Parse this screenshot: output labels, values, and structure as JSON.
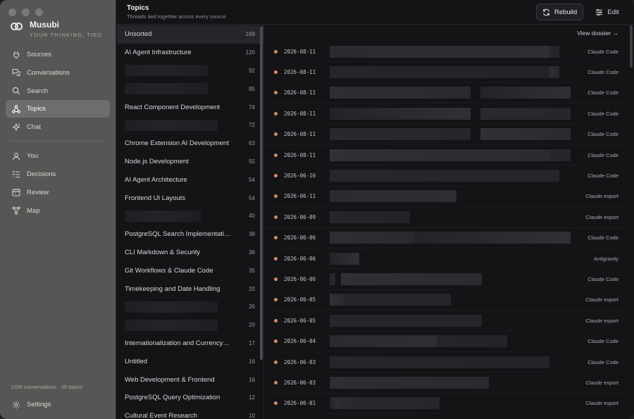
{
  "app": {
    "name": "Musubi",
    "tagline": "YOUR THINKING, TIED"
  },
  "sidebar": {
    "primary": [
      {
        "label": "Sources",
        "icon": "plug-icon",
        "active": false
      },
      {
        "label": "Conversations",
        "icon": "chat-bubbles-icon",
        "active": false
      },
      {
        "label": "Search",
        "icon": "search-icon",
        "active": false
      },
      {
        "label": "Topics",
        "icon": "topics-graph-icon",
        "active": true
      },
      {
        "label": "Chat",
        "icon": "sparkle-icon",
        "active": false
      }
    ],
    "secondary": [
      {
        "label": "You",
        "icon": "person-icon"
      },
      {
        "label": "Decisions",
        "icon": "checklist-icon"
      },
      {
        "label": "Review",
        "icon": "calendar-icon"
      },
      {
        "label": "Map",
        "icon": "map-nodes-icon"
      }
    ],
    "footer_stats": "1209 conversations · 25 topics",
    "settings_label": "Settings"
  },
  "header": {
    "title": "Topics",
    "subtitle": "Threads tied together across every source",
    "rebuild_label": "Rebuild",
    "edit_label": "Edit"
  },
  "topics": [
    {
      "name": "Unsorted",
      "count": "169",
      "redacted": false,
      "active": true
    },
    {
      "name": "AI Agent Infrastructure",
      "count": "120",
      "redacted": false
    },
    {
      "name": "",
      "count": "92",
      "redacted": true
    },
    {
      "name": "",
      "count": "85",
      "redacted": true
    },
    {
      "name": "React Component Development",
      "count": "74",
      "redacted": false
    },
    {
      "name": "",
      "count": "72",
      "redacted": true
    },
    {
      "name": "Chrome Extension AI Development",
      "count": "63",
      "redacted": false
    },
    {
      "name": "Node.js Development",
      "count": "55",
      "redacted": false
    },
    {
      "name": "AI Agent Architecture",
      "count": "54",
      "redacted": false
    },
    {
      "name": "Frontend UI Layouts",
      "count": "54",
      "redacted": false
    },
    {
      "name": "",
      "count": "40",
      "redacted": true
    },
    {
      "name": "PostgreSQL Search Implementation",
      "count": "38",
      "redacted": false
    },
    {
      "name": "CLI Markdown & Security",
      "count": "36",
      "redacted": false
    },
    {
      "name": "Git Workflows & Claude Code",
      "count": "35",
      "redacted": false
    },
    {
      "name": "Timekeeping and Date Handling",
      "count": "33",
      "redacted": false
    },
    {
      "name": "",
      "count": "26",
      "redacted": true
    },
    {
      "name": "",
      "count": "20",
      "redacted": true
    },
    {
      "name": "Internationalization and Currency H...",
      "count": "17",
      "redacted": false
    },
    {
      "name": "Untitled",
      "count": "16",
      "redacted": false
    },
    {
      "name": "Web Development & Frontend",
      "count": "16",
      "redacted": false
    },
    {
      "name": "PostgreSQL Query Optimization",
      "count": "12",
      "redacted": false
    },
    {
      "name": "Cultural Event Research",
      "count": "10",
      "redacted": false
    }
  ],
  "conversations_panel": {
    "view_dossier_label": "View dossier →",
    "items": [
      {
        "date": "2026-08-11",
        "source": "Claude Code"
      },
      {
        "date": "2026-08-11",
        "source": "Claude Code"
      },
      {
        "date": "2026-08-11",
        "source": "Claude Code"
      },
      {
        "date": "2026-08-11",
        "source": "Claude Code"
      },
      {
        "date": "2026-08-11",
        "source": "Claude Code"
      },
      {
        "date": "2026-08-11",
        "source": "Claude Code"
      },
      {
        "date": "2026-06-16",
        "source": "Claude Code"
      },
      {
        "date": "2026-06-11",
        "source": "Claude export"
      },
      {
        "date": "2026-06-09",
        "source": "Claude export"
      },
      {
        "date": "2026-06-06",
        "source": "Claude Code"
      },
      {
        "date": "2026-06-06",
        "source": "Antigravity"
      },
      {
        "date": "2026-06-06",
        "source": "Claude Code"
      },
      {
        "date": "2026-06-05",
        "source": "Claude export"
      },
      {
        "date": "2026-06-05",
        "source": "Claude export"
      },
      {
        "date": "2026-06-04",
        "source": "Claude Code"
      },
      {
        "date": "2026-06-03",
        "source": "Claude Code"
      },
      {
        "date": "2026-06-03",
        "source": "Claude export"
      },
      {
        "date": "2026-06-01",
        "source": "Claude export"
      }
    ]
  },
  "colors": {
    "sidebar_bg": "#565654",
    "content_bg": "#141417",
    "status_dot": "#d98a68"
  }
}
